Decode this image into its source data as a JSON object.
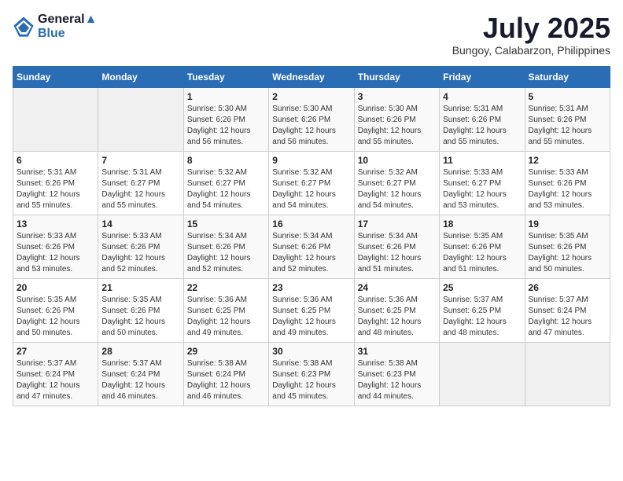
{
  "header": {
    "logo_line1": "General",
    "logo_line2": "Blue",
    "month_year": "July 2025",
    "location": "Bungoy, Calabarzon, Philippines"
  },
  "weekdays": [
    "Sunday",
    "Monday",
    "Tuesday",
    "Wednesday",
    "Thursday",
    "Friday",
    "Saturday"
  ],
  "weeks": [
    [
      {
        "day": "",
        "info": ""
      },
      {
        "day": "",
        "info": ""
      },
      {
        "day": "1",
        "info": "Sunrise: 5:30 AM\nSunset: 6:26 PM\nDaylight: 12 hours\nand 56 minutes."
      },
      {
        "day": "2",
        "info": "Sunrise: 5:30 AM\nSunset: 6:26 PM\nDaylight: 12 hours\nand 56 minutes."
      },
      {
        "day": "3",
        "info": "Sunrise: 5:30 AM\nSunset: 6:26 PM\nDaylight: 12 hours\nand 55 minutes."
      },
      {
        "day": "4",
        "info": "Sunrise: 5:31 AM\nSunset: 6:26 PM\nDaylight: 12 hours\nand 55 minutes."
      },
      {
        "day": "5",
        "info": "Sunrise: 5:31 AM\nSunset: 6:26 PM\nDaylight: 12 hours\nand 55 minutes."
      }
    ],
    [
      {
        "day": "6",
        "info": "Sunrise: 5:31 AM\nSunset: 6:26 PM\nDaylight: 12 hours\nand 55 minutes."
      },
      {
        "day": "7",
        "info": "Sunrise: 5:31 AM\nSunset: 6:27 PM\nDaylight: 12 hours\nand 55 minutes."
      },
      {
        "day": "8",
        "info": "Sunrise: 5:32 AM\nSunset: 6:27 PM\nDaylight: 12 hours\nand 54 minutes."
      },
      {
        "day": "9",
        "info": "Sunrise: 5:32 AM\nSunset: 6:27 PM\nDaylight: 12 hours\nand 54 minutes."
      },
      {
        "day": "10",
        "info": "Sunrise: 5:32 AM\nSunset: 6:27 PM\nDaylight: 12 hours\nand 54 minutes."
      },
      {
        "day": "11",
        "info": "Sunrise: 5:33 AM\nSunset: 6:27 PM\nDaylight: 12 hours\nand 53 minutes."
      },
      {
        "day": "12",
        "info": "Sunrise: 5:33 AM\nSunset: 6:26 PM\nDaylight: 12 hours\nand 53 minutes."
      }
    ],
    [
      {
        "day": "13",
        "info": "Sunrise: 5:33 AM\nSunset: 6:26 PM\nDaylight: 12 hours\nand 53 minutes."
      },
      {
        "day": "14",
        "info": "Sunrise: 5:33 AM\nSunset: 6:26 PM\nDaylight: 12 hours\nand 52 minutes."
      },
      {
        "day": "15",
        "info": "Sunrise: 5:34 AM\nSunset: 6:26 PM\nDaylight: 12 hours\nand 52 minutes."
      },
      {
        "day": "16",
        "info": "Sunrise: 5:34 AM\nSunset: 6:26 PM\nDaylight: 12 hours\nand 52 minutes."
      },
      {
        "day": "17",
        "info": "Sunrise: 5:34 AM\nSunset: 6:26 PM\nDaylight: 12 hours\nand 51 minutes."
      },
      {
        "day": "18",
        "info": "Sunrise: 5:35 AM\nSunset: 6:26 PM\nDaylight: 12 hours\nand 51 minutes."
      },
      {
        "day": "19",
        "info": "Sunrise: 5:35 AM\nSunset: 6:26 PM\nDaylight: 12 hours\nand 50 minutes."
      }
    ],
    [
      {
        "day": "20",
        "info": "Sunrise: 5:35 AM\nSunset: 6:26 PM\nDaylight: 12 hours\nand 50 minutes."
      },
      {
        "day": "21",
        "info": "Sunrise: 5:35 AM\nSunset: 6:26 PM\nDaylight: 12 hours\nand 50 minutes."
      },
      {
        "day": "22",
        "info": "Sunrise: 5:36 AM\nSunset: 6:25 PM\nDaylight: 12 hours\nand 49 minutes."
      },
      {
        "day": "23",
        "info": "Sunrise: 5:36 AM\nSunset: 6:25 PM\nDaylight: 12 hours\nand 49 minutes."
      },
      {
        "day": "24",
        "info": "Sunrise: 5:36 AM\nSunset: 6:25 PM\nDaylight: 12 hours\nand 48 minutes."
      },
      {
        "day": "25",
        "info": "Sunrise: 5:37 AM\nSunset: 6:25 PM\nDaylight: 12 hours\nand 48 minutes."
      },
      {
        "day": "26",
        "info": "Sunrise: 5:37 AM\nSunset: 6:24 PM\nDaylight: 12 hours\nand 47 minutes."
      }
    ],
    [
      {
        "day": "27",
        "info": "Sunrise: 5:37 AM\nSunset: 6:24 PM\nDaylight: 12 hours\nand 47 minutes."
      },
      {
        "day": "28",
        "info": "Sunrise: 5:37 AM\nSunset: 6:24 PM\nDaylight: 12 hours\nand 46 minutes."
      },
      {
        "day": "29",
        "info": "Sunrise: 5:38 AM\nSunset: 6:24 PM\nDaylight: 12 hours\nand 46 minutes."
      },
      {
        "day": "30",
        "info": "Sunrise: 5:38 AM\nSunset: 6:23 PM\nDaylight: 12 hours\nand 45 minutes."
      },
      {
        "day": "31",
        "info": "Sunrise: 5:38 AM\nSunset: 6:23 PM\nDaylight: 12 hours\nand 44 minutes."
      },
      {
        "day": "",
        "info": ""
      },
      {
        "day": "",
        "info": ""
      }
    ]
  ]
}
